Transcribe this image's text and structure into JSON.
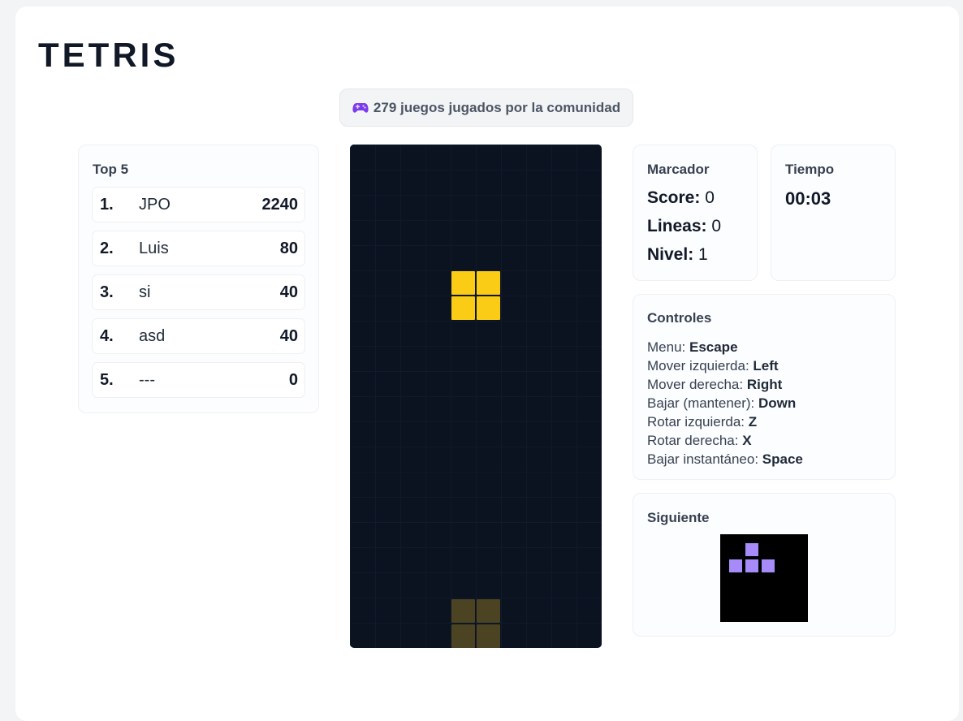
{
  "title": "TETRIS",
  "community": {
    "count": "279",
    "text": "279 juegos jugados por la comunidad"
  },
  "leaderboard": {
    "title": "Top 5",
    "entries": [
      {
        "rank": "1.",
        "name": "JPO",
        "score": "2240"
      },
      {
        "rank": "2.",
        "name": "Luis",
        "score": "80"
      },
      {
        "rank": "3.",
        "name": "si",
        "score": "40"
      },
      {
        "rank": "4.",
        "name": "asd",
        "score": "40"
      },
      {
        "rank": "5.",
        "name": "---",
        "score": "0"
      }
    ]
  },
  "board": {
    "columns": 10,
    "rows": 20,
    "background": "#0b1220",
    "active_piece": {
      "type": "O",
      "color": "#facc15"
    },
    "ghost_piece": {
      "type": "O",
      "color": "#4b4321"
    }
  },
  "scoreboard": {
    "title": "Marcador",
    "score_label": "Score:",
    "score": "0",
    "lines_label": "Lineas:",
    "lines": "0",
    "level_label": "Nivel:",
    "level": "1"
  },
  "timer": {
    "title": "Tiempo",
    "value": "00:03"
  },
  "controls": {
    "title": "Controles",
    "items": [
      {
        "action": "Menu:",
        "key": "Escape"
      },
      {
        "action": "Mover izquierda:",
        "key": "Left"
      },
      {
        "action": "Mover derecha:",
        "key": "Right"
      },
      {
        "action": "Bajar (mantener):",
        "key": "Down"
      },
      {
        "action": "Rotar izquierda:",
        "key": "Z"
      },
      {
        "action": "Rotar derecha:",
        "key": "X"
      },
      {
        "action": "Bajar instantáneo:",
        "key": "Space"
      }
    ]
  },
  "next": {
    "title": "Siguiente",
    "piece": "T",
    "color": "#a78bfa"
  },
  "icons": {
    "community": "gamepad-icon"
  }
}
